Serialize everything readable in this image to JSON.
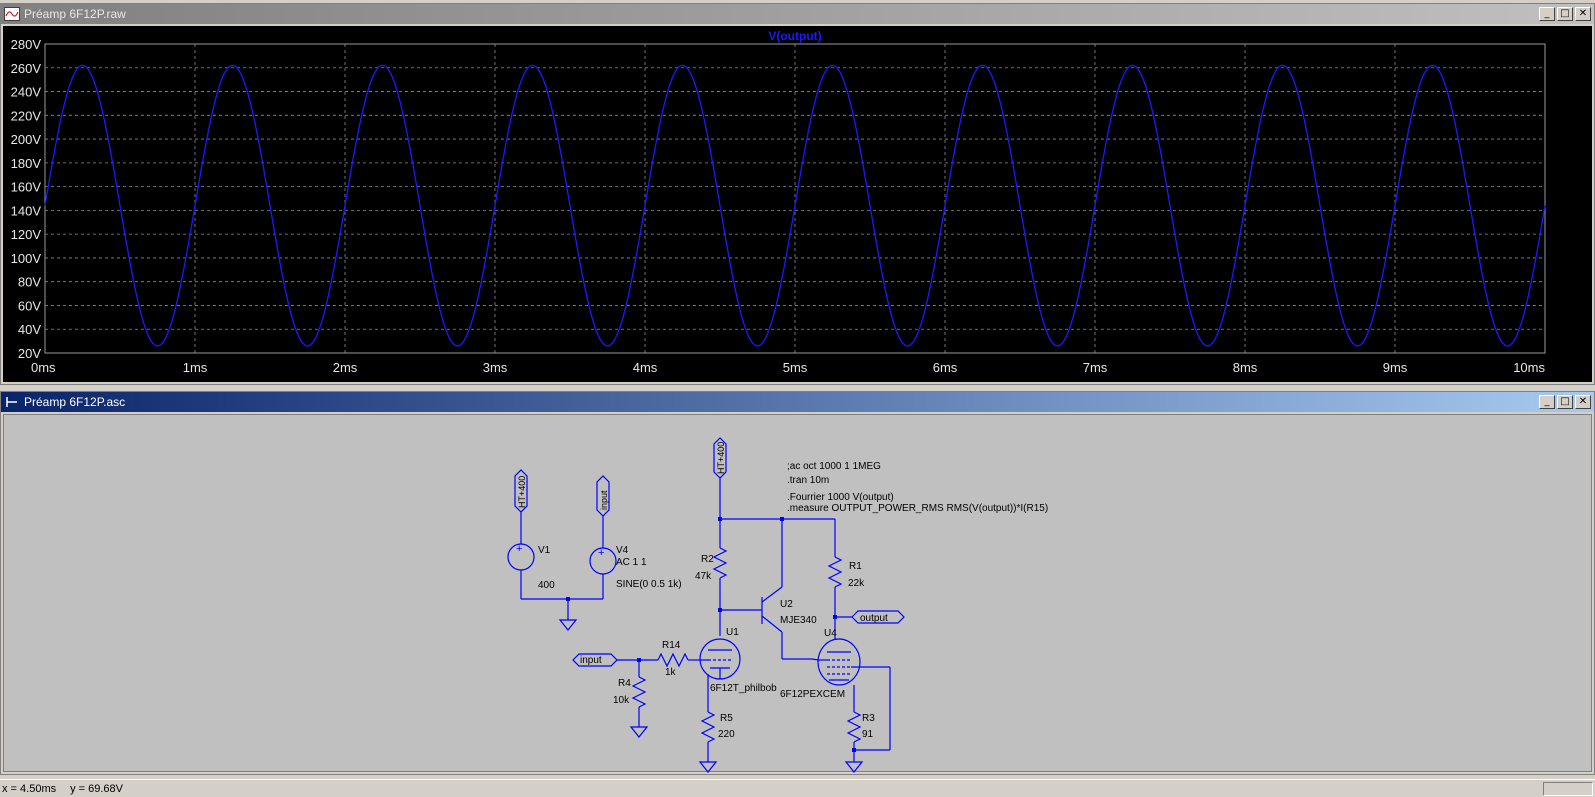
{
  "plot_window": {
    "title": "Préamp 6F12P.raw",
    "trace_label": "V(output)",
    "trace_color": "#1a1aff",
    "buttons": {
      "minimize": "_",
      "maximize": "□",
      "close": "✕"
    }
  },
  "chart_data": {
    "type": "line",
    "title": "V(output)",
    "xlabel": "",
    "ylabel": "",
    "x_unit": "ms",
    "y_unit": "V",
    "xlim": [
      0,
      10
    ],
    "ylim": [
      20,
      280
    ],
    "x_ticks": [
      "0ms",
      "1ms",
      "2ms",
      "3ms",
      "4ms",
      "5ms",
      "6ms",
      "7ms",
      "8ms",
      "9ms",
      "10ms"
    ],
    "y_ticks": [
      "280V",
      "260V",
      "240V",
      "220V",
      "200V",
      "180V",
      "160V",
      "140V",
      "120V",
      "100V",
      "80V",
      "60V",
      "40V",
      "20V"
    ],
    "grid": true,
    "series": [
      {
        "name": "V(output)",
        "color": "#1a1aff",
        "waveform": "sine",
        "offset_v": 144,
        "amplitude_v": 118,
        "frequency_khz": 1,
        "start_time_ms": 0
      }
    ]
  },
  "schematic_window": {
    "title": "Préamp 6F12P.asc",
    "buttons": {
      "minimize": "_",
      "maximize": "□",
      "close": "✕"
    },
    "wire_color": "#0000ff",
    "directives": [
      ";ac oct 1000 1 1MEG",
      ".tran 10m",
      ".Fourrier 1000 V(output)",
      ".measure OUTPUT_POWER_RMS RMS(V(output))*I(R15)"
    ],
    "labels": {
      "ht1": "HT+400",
      "ht2": "HT+400",
      "input_flag1": "input",
      "input_flag2": "input",
      "output_flag": "output",
      "v1_name": "V1",
      "v1_value": "400",
      "v4_name": "V4",
      "v4_ac": "AC 1 1",
      "v4_sine": "SINE(0 0.5 1k)",
      "r1_name": "R1",
      "r1_value": "22k",
      "r2_name": "R2",
      "r2_value": "47k",
      "r3_name": "R3",
      "r3_value": "91",
      "r4_name": "R4",
      "r4_value": "10k",
      "r5_name": "R5",
      "r5_value": "220",
      "r14_name": "R14",
      "r14_value": "1k",
      "u1_name": "U1",
      "u1_model": "6F12T_philbob",
      "u2_name": "U2",
      "u2_model": "MJE340",
      "u4_name": "U4",
      "u4_model": "6F12PEXCEM"
    }
  },
  "status": {
    "x_readout": "x = 4.50ms",
    "y_readout": "y = 69.68V"
  }
}
